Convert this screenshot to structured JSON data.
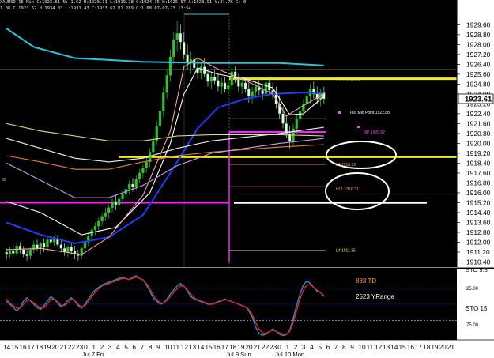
{
  "header": {
    "line1": "XAUUSD 15 Min  C:1923.61  N: 1.62  H:1920.11  L:1919.28  O:1924.35  H:1925.07  A:1923.91  V:31.7K  C: 0",
    "line2": "1.08  C:1923.62  H:1934.03  L:1931.43  C:1933.62  V1.289  O:1.08  07-07-23  13:54"
  },
  "colors": {
    "background": "#000000",
    "price_axis_bg": "#ffffff",
    "bull_candle": "#33c233",
    "bear_candle": "#e8ffe8",
    "cyan_ma": "#26c6da",
    "blue_ma": "#1e3cff",
    "white_ma": "#ffffff",
    "pink_ma": "#f4a0a8",
    "yellow_ma": "#e8e07a",
    "orange_ma": "#e0803c",
    "lavender_ma": "#c8a0e8",
    "yellow_level": "#f2ee1c",
    "magenta_level": "#ff20ff",
    "stoch_blue": "#2a8fd0",
    "stoch_red": "#e02020",
    "stoch_dash": "#66ccff",
    "td_label": "#ff9933"
  },
  "chart_data": {
    "type": "candlestick",
    "symbol": "XAUUSD",
    "interval": "15 Min",
    "ylim": [
      1910.4,
      1930.1
    ],
    "y_ticks": [
      1929.6,
      1928.8,
      1928.0,
      1927.2,
      1926.4,
      1925.6,
      1924.8,
      1924.0,
      1923.2,
      1922.4,
      1921.6,
      1920.8,
      1920.0,
      1919.2,
      1918.4,
      1917.6,
      1916.8,
      1916.0,
      1915.2,
      1914.4,
      1913.6,
      1912.8,
      1912.0,
      1911.2,
      1910.4
    ],
    "y_tick_labels": [
      "1929.60",
      "1928.80",
      "1928.00",
      "1927.20",
      "1926.40",
      "1925.60",
      "1924.80",
      "1924.00",
      "1923.20",
      "1922.40",
      "1921.60",
      "1920.80",
      "1920.00",
      "1919.20",
      "1918.40",
      "1917.60",
      "1916.80",
      "1916.00",
      "1915.20",
      "1914.40",
      "1913.60",
      "1912.80",
      "1912.00",
      "1911.20",
      "1910.40"
    ],
    "last_price_label": "1923.61",
    "last_price": 1923.61,
    "x_tick_labels": [
      "14",
      "15",
      "16",
      "17",
      "18",
      "19",
      "20",
      "21",
      "22",
      "23",
      "0",
      "1",
      "2",
      "3",
      "4",
      "5",
      "6",
      "7",
      "8",
      "9",
      "10",
      "11",
      "12",
      "13",
      "14",
      "15",
      "16",
      "17",
      "18",
      "19",
      "20",
      "21",
      "22",
      "23",
      "0",
      "1",
      "2",
      "3",
      "4",
      "5",
      "6",
      "7",
      "8",
      "9",
      "10",
      "11",
      "12",
      "13",
      "14",
      "15",
      "16",
      "17",
      "18",
      "19",
      "20",
      "21"
    ],
    "date_labels": [
      "Jul 7 Fri",
      "Jul 9 Sun",
      "Jul 10 Mon"
    ],
    "levels": [
      {
        "label": "RMR 1925.23",
        "value": 1925.23,
        "color": "#e8e855"
      },
      {
        "label": "Test Mid Point 1922.88",
        "value": 1922.0,
        "color": "#ffffff"
      },
      {
        "label": "MP 1920.92",
        "value": 1920.92,
        "color": "#ff40ff"
      },
      {
        "label": "L3 1918.29",
        "value": 1918.29,
        "color": "#ff9a60"
      },
      {
        "label": "HL1 1916.31",
        "value": 1916.31,
        "color": "#ff9a60"
      },
      {
        "label": "L4 1911.35",
        "value": 1911.35,
        "color": "#e8e855"
      }
    ],
    "candles": [
      [
        1911.2,
        1911.5,
        1910.6,
        1911.0
      ],
      [
        1911.0,
        1911.6,
        1910.7,
        1911.3
      ],
      [
        1911.3,
        1911.8,
        1910.9,
        1911.1
      ],
      [
        1911.1,
        1911.9,
        1910.9,
        1911.7
      ],
      [
        1911.7,
        1912.0,
        1911.1,
        1911.4
      ],
      [
        1911.4,
        1911.7,
        1910.8,
        1911.0
      ],
      [
        1911.0,
        1911.4,
        1910.5,
        1910.9
      ],
      [
        1910.9,
        1911.6,
        1910.6,
        1911.4
      ],
      [
        1911.4,
        1912.1,
        1911.1,
        1911.8
      ],
      [
        1911.8,
        1912.2,
        1911.3,
        1911.5
      ],
      [
        1911.5,
        1912.0,
        1911.0,
        1911.9
      ],
      [
        1911.9,
        1912.3,
        1911.2,
        1911.6
      ],
      [
        1911.6,
        1912.4,
        1911.3,
        1912.2
      ],
      [
        1912.2,
        1912.6,
        1911.6,
        1912.0
      ],
      [
        1912.0,
        1912.5,
        1911.7,
        1912.3
      ],
      [
        1912.3,
        1912.6,
        1911.6,
        1911.8
      ],
      [
        1911.8,
        1912.2,
        1911.2,
        1911.5
      ],
      [
        1911.5,
        1911.9,
        1910.9,
        1911.2
      ],
      [
        1911.2,
        1911.8,
        1910.8,
        1911.6
      ],
      [
        1911.6,
        1912.0,
        1911.0,
        1911.3
      ],
      [
        1911.3,
        1911.7,
        1910.6,
        1911.0
      ],
      [
        1911.0,
        1911.4,
        1910.5,
        1910.9
      ],
      [
        1910.9,
        1911.6,
        1910.6,
        1911.5
      ],
      [
        1911.5,
        1912.2,
        1911.2,
        1912.0
      ],
      [
        1912.0,
        1912.8,
        1911.7,
        1912.5
      ],
      [
        1912.5,
        1913.2,
        1912.2,
        1913.0
      ],
      [
        1913.0,
        1913.6,
        1912.6,
        1913.3
      ],
      [
        1913.3,
        1914.0,
        1912.9,
        1913.7
      ],
      [
        1913.7,
        1914.4,
        1913.3,
        1914.1
      ],
      [
        1914.1,
        1914.8,
        1913.7,
        1914.4
      ],
      [
        1914.4,
        1915.0,
        1913.9,
        1914.8
      ],
      [
        1914.8,
        1915.6,
        1914.4,
        1915.3
      ],
      [
        1915.3,
        1915.8,
        1914.6,
        1915.0
      ],
      [
        1915.0,
        1915.7,
        1914.6,
        1915.5
      ],
      [
        1915.5,
        1916.2,
        1915.1,
        1915.9
      ],
      [
        1915.9,
        1916.6,
        1915.4,
        1916.3
      ],
      [
        1916.3,
        1917.0,
        1915.9,
        1916.7
      ],
      [
        1916.7,
        1917.2,
        1916.1,
        1916.5
      ],
      [
        1916.5,
        1917.4,
        1916.2,
        1917.1
      ],
      [
        1917.1,
        1917.9,
        1916.8,
        1917.6
      ],
      [
        1917.6,
        1918.3,
        1917.2,
        1918.0
      ],
      [
        1918.0,
        1918.8,
        1917.6,
        1918.5
      ],
      [
        1918.5,
        1919.6,
        1918.1,
        1919.3
      ],
      [
        1919.3,
        1920.6,
        1918.9,
        1920.2
      ],
      [
        1920.2,
        1921.8,
        1919.8,
        1921.4
      ],
      [
        1921.4,
        1923.0,
        1920.9,
        1922.6
      ],
      [
        1922.6,
        1924.6,
        1922.1,
        1924.1
      ],
      [
        1924.1,
        1926.0,
        1923.6,
        1925.5
      ],
      [
        1925.5,
        1927.6,
        1925.0,
        1927.0
      ],
      [
        1927.0,
        1929.0,
        1926.4,
        1928.4
      ],
      [
        1928.4,
        1929.9,
        1927.4,
        1928.9
      ],
      [
        1928.9,
        1929.6,
        1927.6,
        1928.2
      ],
      [
        1928.2,
        1929.0,
        1926.8,
        1927.2
      ],
      [
        1927.2,
        1928.0,
        1926.0,
        1926.6
      ],
      [
        1926.6,
        1927.4,
        1925.6,
        1926.8
      ],
      [
        1926.8,
        1927.2,
        1925.8,
        1926.1
      ],
      [
        1926.1,
        1926.8,
        1925.2,
        1925.7
      ],
      [
        1925.7,
        1926.6,
        1925.2,
        1926.2
      ],
      [
        1926.2,
        1926.9,
        1925.4,
        1925.6
      ],
      [
        1925.6,
        1926.0,
        1924.6,
        1925.0
      ],
      [
        1925.0,
        1925.8,
        1924.4,
        1925.4
      ],
      [
        1925.4,
        1926.0,
        1924.8,
        1925.1
      ],
      [
        1925.1,
        1925.6,
        1924.2,
        1924.6
      ],
      [
        1924.6,
        1925.3,
        1924.0,
        1924.9
      ],
      [
        1924.9,
        1925.4,
        1924.1,
        1924.4
      ],
      [
        1924.4,
        1925.0,
        1923.9,
        1924.7
      ],
      [
        1924.7,
        1926.6,
        1924.3,
        1925.8
      ],
      [
        1925.8,
        1926.2,
        1924.9,
        1925.2
      ],
      [
        1925.2,
        1925.6,
        1924.2,
        1924.6
      ],
      [
        1924.6,
        1925.2,
        1924.0,
        1924.9
      ],
      [
        1924.9,
        1925.4,
        1924.1,
        1924.4
      ],
      [
        1924.4,
        1924.9,
        1923.3,
        1923.8
      ],
      [
        1923.8,
        1924.6,
        1923.2,
        1924.2
      ],
      [
        1924.2,
        1925.0,
        1923.8,
        1924.6
      ],
      [
        1924.6,
        1925.1,
        1923.9,
        1924.3
      ],
      [
        1924.3,
        1924.8,
        1923.5,
        1924.0
      ],
      [
        1924.0,
        1925.3,
        1923.6,
        1924.9
      ],
      [
        1924.9,
        1925.4,
        1924.0,
        1924.3
      ],
      [
        1924.3,
        1924.9,
        1923.6,
        1924.1
      ],
      [
        1924.1,
        1924.6,
        1922.8,
        1923.2
      ],
      [
        1923.2,
        1923.9,
        1922.0,
        1922.4
      ],
      [
        1922.4,
        1923.0,
        1921.2,
        1921.6
      ],
      [
        1921.6,
        1922.2,
        1920.4,
        1920.8
      ],
      [
        1920.8,
        1921.4,
        1919.6,
        1920.2
      ],
      [
        1920.2,
        1921.6,
        1919.8,
        1921.2
      ],
      [
        1921.2,
        1922.4,
        1920.8,
        1922.0
      ],
      [
        1922.0,
        1923.0,
        1921.6,
        1922.6
      ],
      [
        1922.6,
        1923.6,
        1922.2,
        1923.2
      ],
      [
        1923.2,
        1924.2,
        1922.8,
        1923.8
      ],
      [
        1923.8,
        1924.8,
        1923.2,
        1924.4
      ],
      [
        1924.4,
        1925.0,
        1923.6,
        1924.0
      ],
      [
        1924.0,
        1924.6,
        1923.2,
        1923.6
      ],
      [
        1923.6,
        1924.4,
        1923.0,
        1924.1
      ],
      [
        1924.1,
        1924.6,
        1923.2,
        1923.61
      ]
    ],
    "ma_lines": [
      {
        "name": "cyan",
        "color": "#26c6da",
        "points": [
          [
            0,
            1929.3
          ],
          [
            8,
            1927.8
          ],
          [
            20,
            1926.9
          ],
          [
            40,
            1926.6
          ],
          [
            60,
            1926.5
          ],
          [
            80,
            1926.5
          ],
          [
            93,
            1926.3
          ]
        ]
      },
      {
        "name": "blue",
        "color": "#1e3cff",
        "points": [
          [
            0,
            1913.6
          ],
          [
            10,
            1912.6
          ],
          [
            20,
            1911.9
          ],
          [
            30,
            1912.4
          ],
          [
            40,
            1914.2
          ],
          [
            48,
            1917.6
          ],
          [
            56,
            1921.2
          ],
          [
            62,
            1922.9
          ],
          [
            70,
            1923.6
          ],
          [
            78,
            1924.0
          ],
          [
            86,
            1924.1
          ],
          [
            93,
            1924.1
          ]
        ]
      },
      {
        "name": "white",
        "color": "#ffffff",
        "points": [
          [
            0,
            1915.3
          ],
          [
            10,
            1914.4
          ],
          [
            22,
            1912.6
          ],
          [
            32,
            1913.2
          ],
          [
            42,
            1916.0
          ],
          [
            48,
            1920.0
          ],
          [
            52,
            1924.0
          ],
          [
            56,
            1926.1
          ],
          [
            62,
            1925.6
          ],
          [
            70,
            1925.2
          ],
          [
            78,
            1924.5
          ],
          [
            83,
            1922.3
          ],
          [
            87,
            1922.4
          ],
          [
            93,
            1923.8
          ]
        ]
      },
      {
        "name": "pink",
        "color": "#f4a0a8",
        "points": [
          [
            0,
            1911.4
          ],
          [
            10,
            1911.5
          ],
          [
            22,
            1911.0
          ],
          [
            30,
            1912.4
          ],
          [
            40,
            1915.8
          ],
          [
            48,
            1921.0
          ],
          [
            52,
            1926.2
          ],
          [
            56,
            1926.9
          ],
          [
            62,
            1926.0
          ],
          [
            70,
            1925.1
          ],
          [
            78,
            1924.0
          ],
          [
            82,
            1922.2
          ],
          [
            86,
            1922.9
          ],
          [
            93,
            1924.0
          ]
        ]
      },
      {
        "name": "yellow",
        "color": "#e8e07a",
        "points": [
          [
            0,
            1921.6
          ],
          [
            10,
            1921.0
          ],
          [
            20,
            1920.6
          ],
          [
            30,
            1920.2
          ],
          [
            40,
            1920.2
          ],
          [
            50,
            1920.6
          ],
          [
            60,
            1920.7
          ],
          [
            70,
            1920.7
          ],
          [
            80,
            1920.7
          ],
          [
            93,
            1920.6
          ]
        ]
      },
      {
        "name": "orange",
        "color": "#e0803c",
        "points": [
          [
            0,
            1919.0
          ],
          [
            10,
            1918.5
          ],
          [
            20,
            1917.9
          ],
          [
            30,
            1917.9
          ],
          [
            40,
            1918.5
          ],
          [
            50,
            1919.0
          ],
          [
            60,
            1919.3
          ],
          [
            70,
            1919.5
          ],
          [
            80,
            1919.7
          ],
          [
            93,
            1919.9
          ]
        ]
      },
      {
        "name": "lavender",
        "color": "#c8a0e8",
        "points": [
          [
            0,
            1918.4
          ],
          [
            10,
            1917.0
          ],
          [
            20,
            1915.6
          ],
          [
            30,
            1915.6
          ],
          [
            40,
            1916.6
          ],
          [
            50,
            1918.2
          ],
          [
            60,
            1919.2
          ],
          [
            70,
            1919.6
          ],
          [
            80,
            1920.0
          ],
          [
            93,
            1920.4
          ]
        ]
      },
      {
        "name": "white2",
        "color": "#f0f0f0",
        "points": [
          [
            0,
            1920.4
          ],
          [
            10,
            1919.6
          ],
          [
            20,
            1918.8
          ],
          [
            30,
            1918.5
          ],
          [
            40,
            1918.8
          ],
          [
            50,
            1919.6
          ],
          [
            60,
            1920.2
          ],
          [
            70,
            1920.5
          ],
          [
            80,
            1920.8
          ],
          [
            93,
            1921.3
          ]
        ]
      }
    ],
    "oscillator": {
      "name": "STO",
      "legend_label": "STO  9.3",
      "value_label": "STO  15",
      "td_label": "883 TD",
      "yrange_label": "2523 YRange",
      "axis_labels": [
        "25.00",
        "75.00"
      ],
      "blue": [
        55,
        50,
        45,
        40,
        45,
        55,
        60,
        55,
        50,
        45,
        42,
        48,
        55,
        62,
        58,
        52,
        46,
        50,
        56,
        60,
        55,
        48,
        44,
        50,
        58,
        66,
        72,
        76,
        80,
        82,
        84,
        86,
        88,
        90,
        92,
        90,
        88,
        92,
        94,
        90,
        88,
        80,
        70,
        60,
        55,
        50,
        52,
        58,
        66,
        72,
        78,
        82,
        78,
        70,
        62,
        58,
        56,
        54,
        52,
        50,
        50,
        52,
        54,
        56,
        58,
        56,
        54,
        52,
        50,
        48,
        46,
        40,
        30,
        15,
        5,
        2,
        4,
        8,
        12,
        8,
        4,
        2,
        3,
        10,
        28,
        48,
        66,
        80,
        86,
        82,
        76,
        70,
        68,
        62
      ],
      "red": [
        58,
        52,
        48,
        44,
        44,
        50,
        56,
        56,
        52,
        48,
        44,
        45,
        50,
        58,
        58,
        54,
        48,
        48,
        52,
        58,
        56,
        50,
        46,
        48,
        54,
        62,
        68,
        74,
        78,
        80,
        82,
        84,
        86,
        88,
        90,
        90,
        88,
        90,
        92,
        90,
        88,
        82,
        74,
        64,
        58,
        52,
        52,
        56,
        62,
        68,
        74,
        78,
        78,
        72,
        66,
        60,
        57,
        55,
        53,
        51,
        50,
        51,
        53,
        55,
        57,
        56,
        54,
        52,
        50,
        48,
        46,
        42,
        34,
        22,
        12,
        6,
        5,
        8,
        10,
        8,
        6,
        4,
        4,
        8,
        22,
        40,
        58,
        72,
        80,
        80,
        76,
        72,
        68,
        64
      ]
    }
  }
}
